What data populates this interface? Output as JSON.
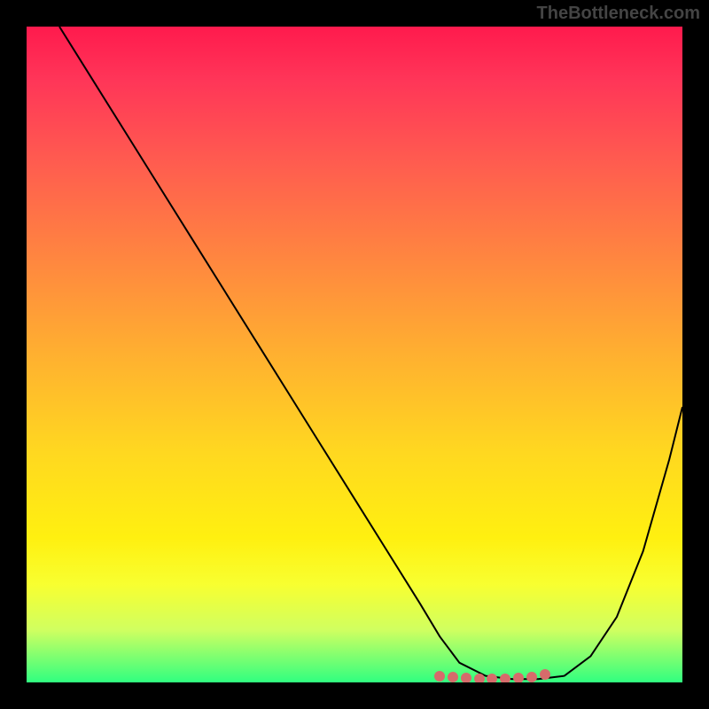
{
  "watermark": "TheBottleneck.com",
  "chart_data": {
    "type": "line",
    "title": "",
    "xlabel": "",
    "ylabel": "",
    "xlim": [
      0,
      100
    ],
    "ylim": [
      0,
      100
    ],
    "grid": false,
    "series": [
      {
        "name": "curve",
        "x": [
          5,
          10,
          15,
          20,
          25,
          30,
          35,
          40,
          45,
          50,
          55,
          60,
          63,
          66,
          70,
          74,
          78,
          82,
          86,
          90,
          94,
          98,
          100
        ],
        "y": [
          100,
          92,
          84,
          76,
          68,
          60,
          52,
          44,
          36,
          28,
          20,
          12,
          7,
          3,
          1,
          0.5,
          0.5,
          1,
          4,
          10,
          20,
          34,
          42
        ]
      }
    ],
    "points": {
      "name": "highlight",
      "color": "#d66b6b",
      "x": [
        63,
        65,
        67,
        69,
        71,
        73,
        75,
        77,
        79
      ],
      "y": [
        1,
        0.8,
        0.7,
        0.6,
        0.6,
        0.6,
        0.7,
        0.8,
        1.2
      ]
    },
    "background_gradient": {
      "top": "#ff1a4d",
      "mid": "#ffd820",
      "bottom": "#30ff80"
    }
  }
}
